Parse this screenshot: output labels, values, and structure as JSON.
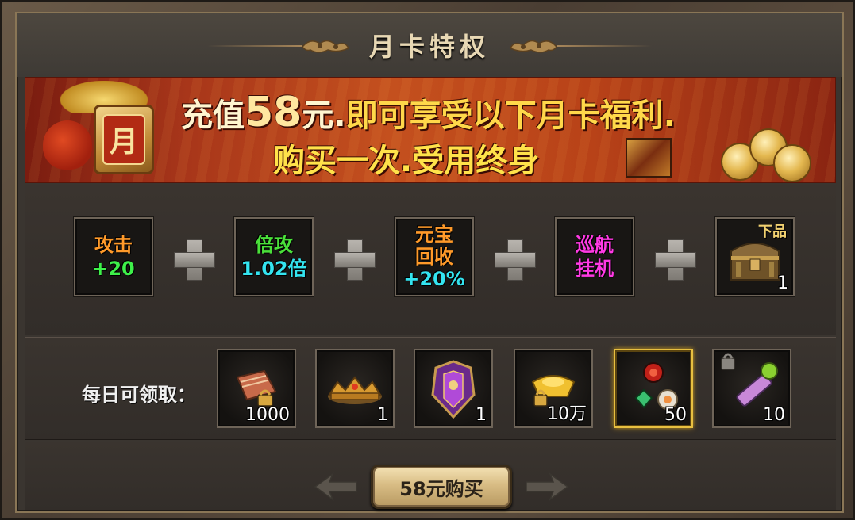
{
  "title": "月卡特权",
  "banner": {
    "line1_prefix": "充值",
    "line1_amount": "58",
    "line1_unit": "元.",
    "line1_suffix": "即可享受以下月卡福利.",
    "line2": "购买一次.受用终身",
    "card_glyph": "月"
  },
  "privileges": [
    {
      "line1": "攻击",
      "line2": "+20",
      "color1": "#ff9a2a",
      "color2": "#3ef04a"
    },
    {
      "line1": "倍攻",
      "line2": "1.02倍",
      "color1": "#4ae03a",
      "color2": "#34e4f0"
    },
    {
      "line1": "元宝",
      "line2": "回收",
      "line3": "+20%",
      "color1": "#ff9a2a",
      "color2": "#ff9a2a",
      "color3": "#34e4f0"
    },
    {
      "line1": "巡航",
      "line2": "挂机",
      "color1": "#ff3ae4",
      "color2": "#ff3ae4"
    },
    {
      "icon": "treasure-chest-icon",
      "badge": "下品",
      "count": "1"
    }
  ],
  "daily": {
    "label": "每日可领取：",
    "items": [
      {
        "icon": "locked-book-icon",
        "count": "1000"
      },
      {
        "icon": "gold-crown-icon",
        "count": "1"
      },
      {
        "icon": "purple-armor-icon",
        "count": "1"
      },
      {
        "icon": "gold-ingot-icon",
        "count": "10万"
      },
      {
        "icon": "gem-orbs-icon",
        "count": "50",
        "highlight": true
      },
      {
        "icon": "locked-scroll-icon",
        "count": "10"
      }
    ]
  },
  "buy": {
    "label": "58元购买"
  }
}
